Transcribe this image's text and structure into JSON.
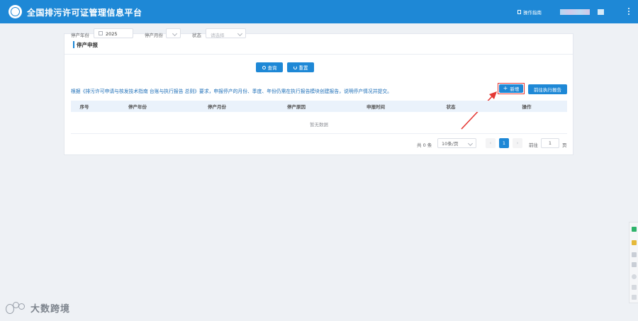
{
  "app": {
    "title": "全国排污许可证管理信息平台",
    "guide_label": "操作指南"
  },
  "page": {
    "title": "停产申报"
  },
  "filters": {
    "year_label": "停产年份",
    "year_value": "2025",
    "month_label": "停产月份",
    "status_label": "状态",
    "status_placeholder": "请选择",
    "search_label": "查询",
    "reset_label": "重置"
  },
  "notice": "根据《排污许可申请与核发技术指南 台账与执行报告 总则》要求，申报停产的月份、季度、年份仍需在执行报告模块创建报告，说明停产情况并提交。",
  "actions": {
    "add_label": "新增",
    "goto_report_label": "前往执行报告"
  },
  "table": {
    "columns": [
      "序号",
      "停产年份",
      "停产月份",
      "停产原因",
      "申报时间",
      "状态",
      "操作"
    ],
    "empty_text": "暂无数据"
  },
  "pagination": {
    "total_text": "共 0 条",
    "page_size": "10条/页",
    "current_page": "1",
    "goto_label": "前往",
    "goto_value": "1",
    "page_unit": "页"
  },
  "watermark": {
    "text": "大数跨境"
  },
  "colors": {
    "primary": "#1e88d6",
    "highlight": "#e53935",
    "table_header": "#eaf2fb"
  }
}
